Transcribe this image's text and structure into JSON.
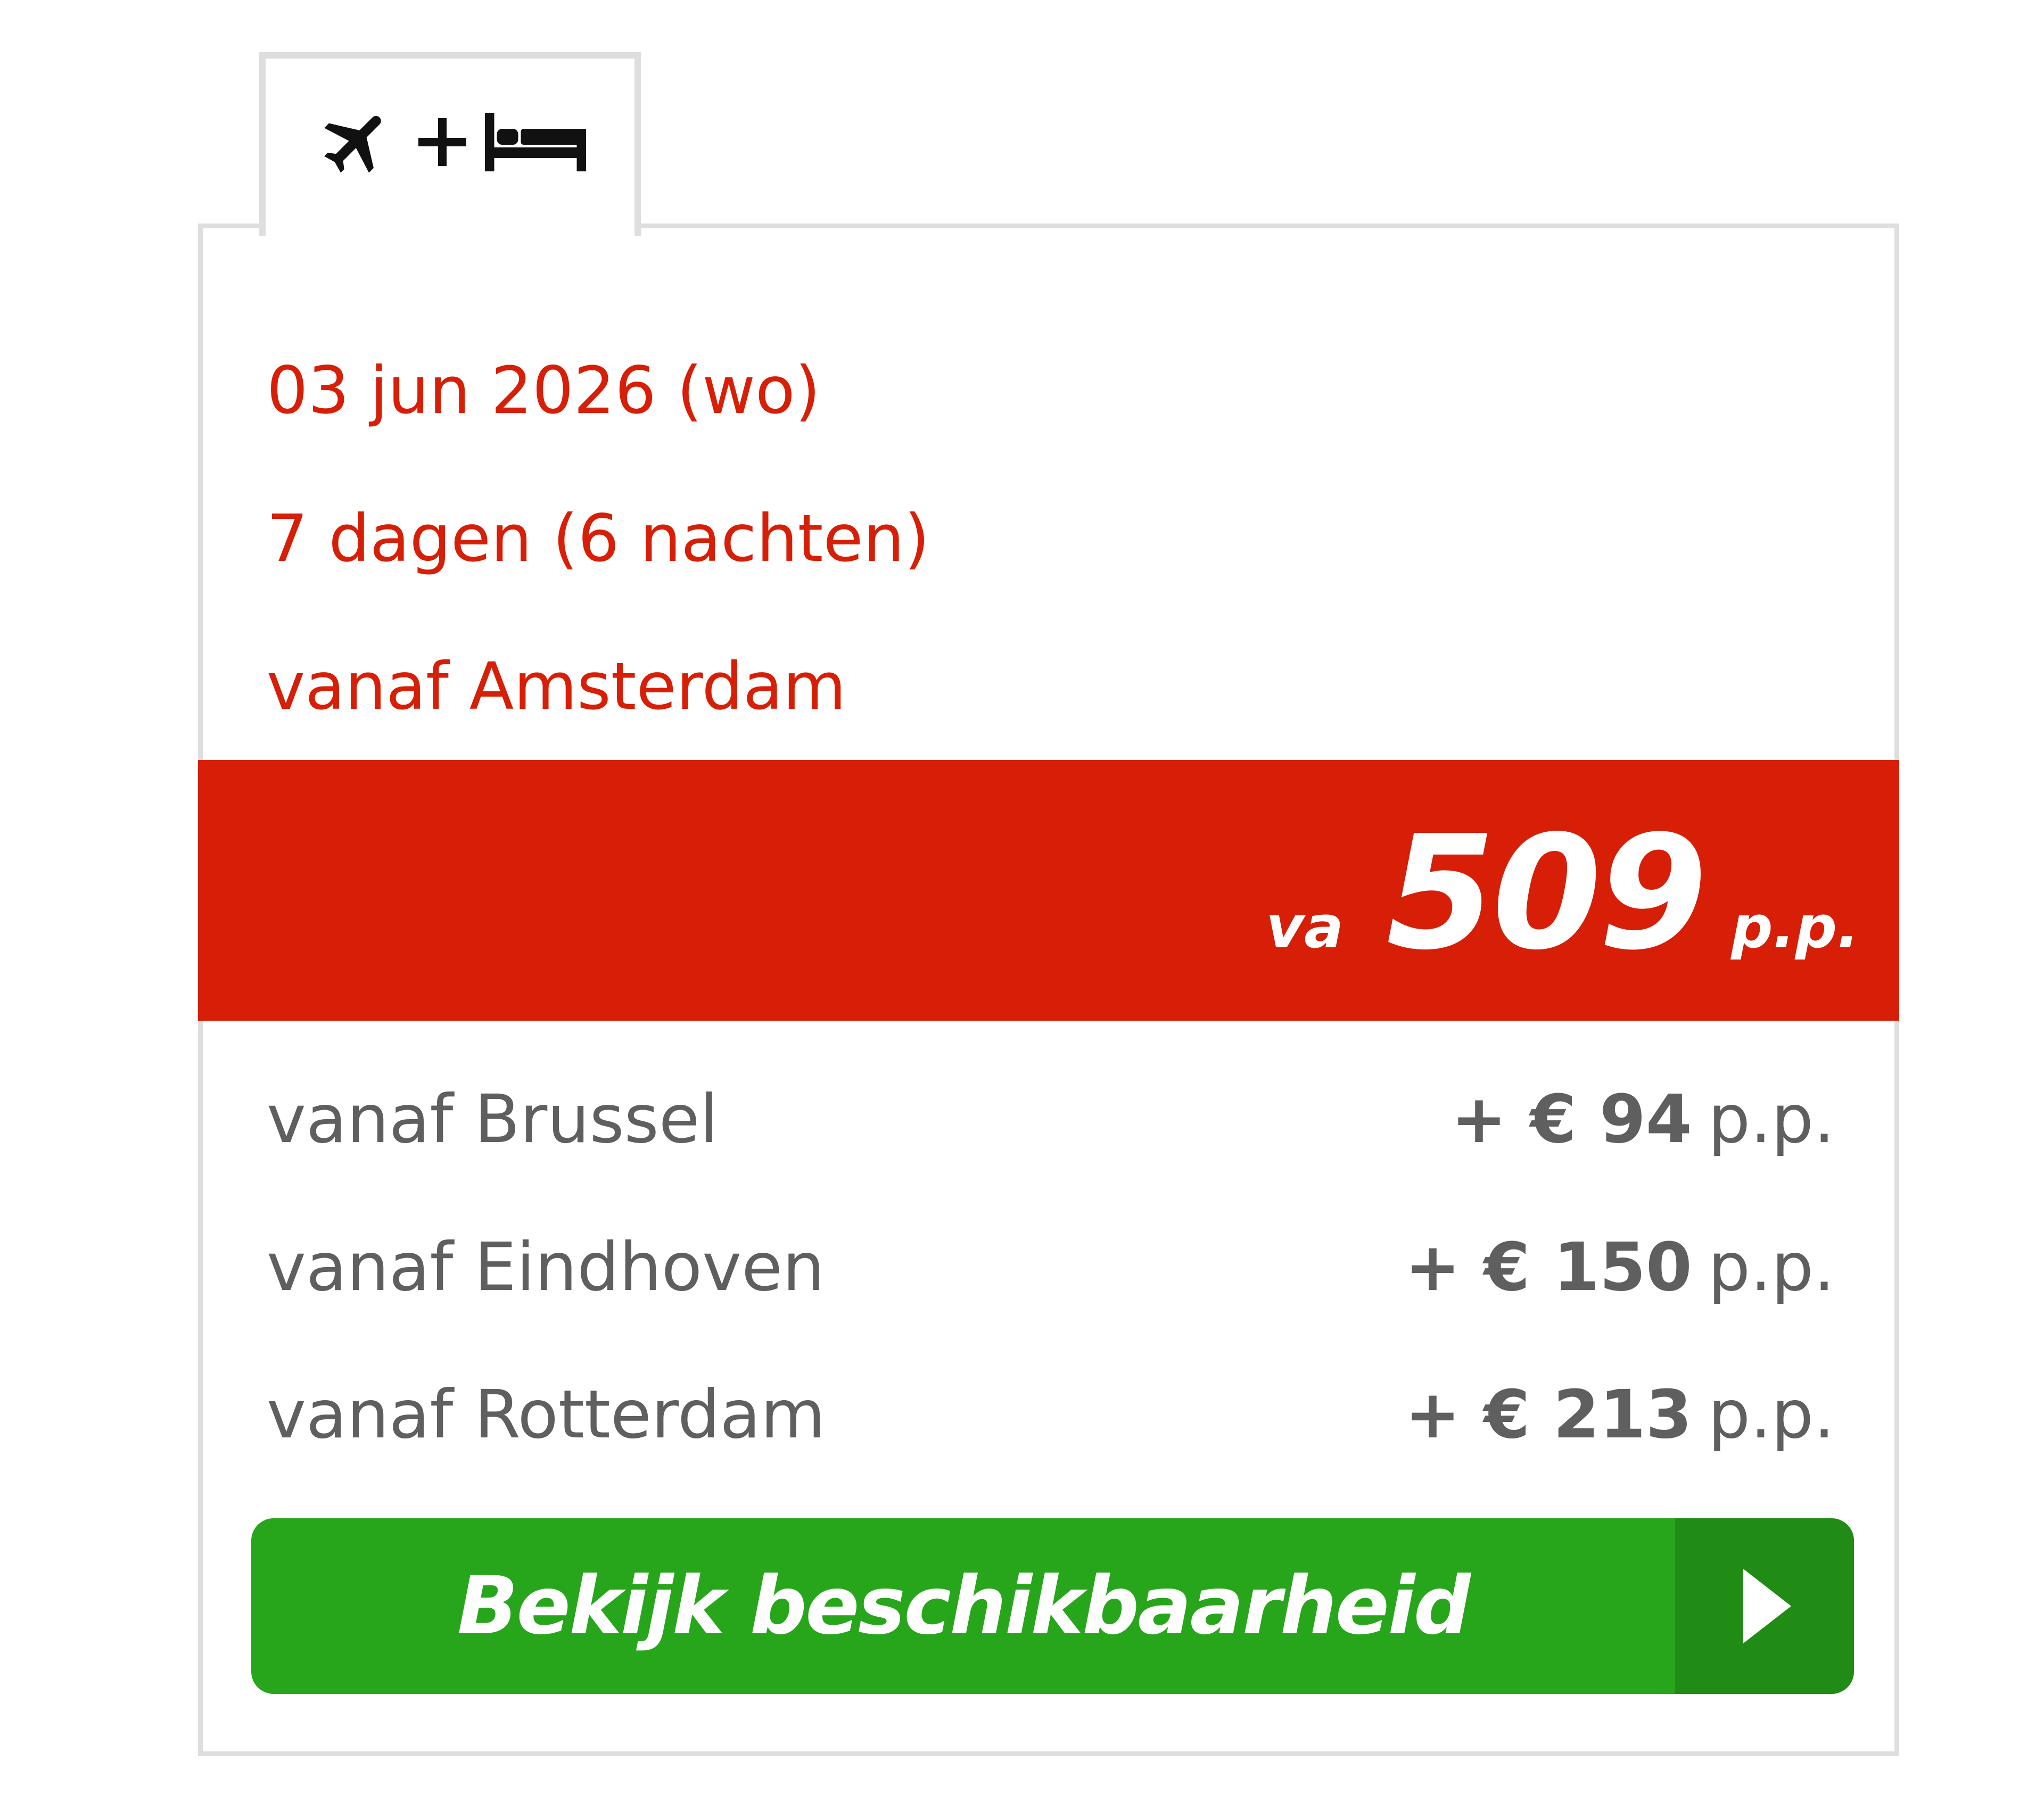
{
  "tab": {
    "icons": [
      "plane-icon",
      "plus-icon",
      "bed-icon"
    ]
  },
  "trip": {
    "date": "03 jun 2026 (wo)",
    "duration": "7 dagen (6 nachten)",
    "departure": "vanaf Amsterdam"
  },
  "price": {
    "prefix": "va",
    "amount": "509",
    "suffix": "p.p."
  },
  "alternatives": [
    {
      "label": "vanaf Brussel",
      "amount": "+ € 94",
      "unit": "p.p."
    },
    {
      "label": "vanaf Eindhoven",
      "amount": "+ € 150",
      "unit": "p.p."
    },
    {
      "label": "vanaf Rotterdam",
      "amount": "+ € 213",
      "unit": "p.p."
    }
  ],
  "cta": {
    "label": "Bekijk beschikbaarheid",
    "icon": "chevron-right-icon"
  },
  "colors": {
    "accent_red": "#d61f06",
    "button_green": "#27a61b",
    "button_green_dark": "#218c15",
    "border": "#dedede",
    "muted_text": "#5f5f5f"
  }
}
